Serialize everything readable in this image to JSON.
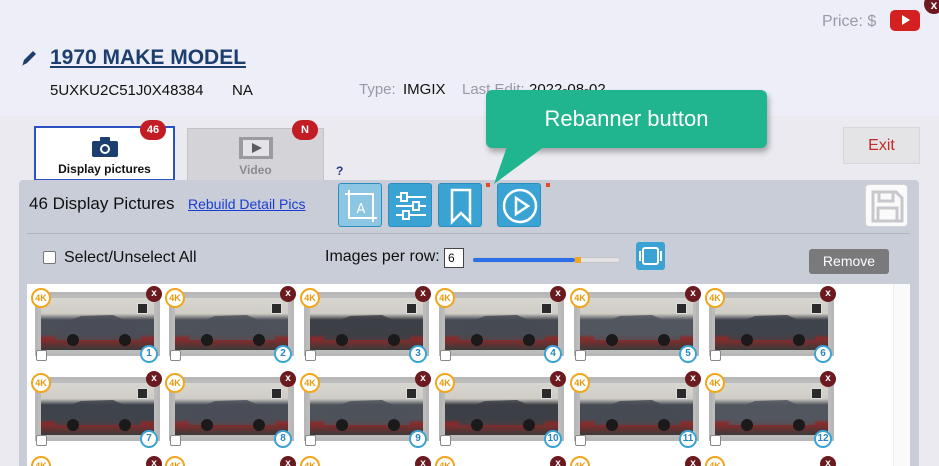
{
  "header": {
    "price_label": "Price: $",
    "title": "1970 MAKE MODEL",
    "vin": "5UXKU2C51J0X48384",
    "condition": "NA",
    "type_label": "Type:",
    "type_value": "IMGIX",
    "last_edit_label": "Last Edit:",
    "last_edit_value": "2022-08-02"
  },
  "tabs": [
    {
      "label": "Display pictures",
      "badge": "46",
      "icon": "camera-icon"
    },
    {
      "label": "Video",
      "badge": "N",
      "icon": "film-icon"
    }
  ],
  "help_label": "?",
  "exit_label": "Exit",
  "callout_label": "Rebanner button",
  "panel": {
    "title": "46 Display Pictures",
    "rebuild_link": "Rebuild Detail Pics",
    "toolbar_icons": [
      "crop-text-icon",
      "sliders-icon",
      "bookmark-icon",
      "play-icon"
    ],
    "select_all_label": "Select/Unselect All",
    "images_per_row_label": "Images per row:",
    "images_per_row_value": "6",
    "slider_fraction": 0.7,
    "remove_label": "Remove"
  },
  "thumbnails": [
    {
      "num": "1",
      "tag": "4K"
    },
    {
      "num": "2",
      "tag": "4K"
    },
    {
      "num": "3",
      "tag": "4K"
    },
    {
      "num": "4",
      "tag": "4K"
    },
    {
      "num": "5",
      "tag": "4K"
    },
    {
      "num": "6",
      "tag": "4K"
    },
    {
      "num": "7",
      "tag": "4K"
    },
    {
      "num": "8",
      "tag": "4K"
    },
    {
      "num": "9",
      "tag": "4K"
    },
    {
      "num": "10",
      "tag": "4K"
    },
    {
      "num": "11",
      "tag": "4K"
    },
    {
      "num": "12",
      "tag": "4K"
    }
  ],
  "thumb_close_label": "x",
  "colors": {
    "accent": "#3aa3d3",
    "callout": "#21b58f",
    "badge": "#c21c24",
    "close": "#6b1a1f",
    "tag_4k": "#f2a61c"
  }
}
